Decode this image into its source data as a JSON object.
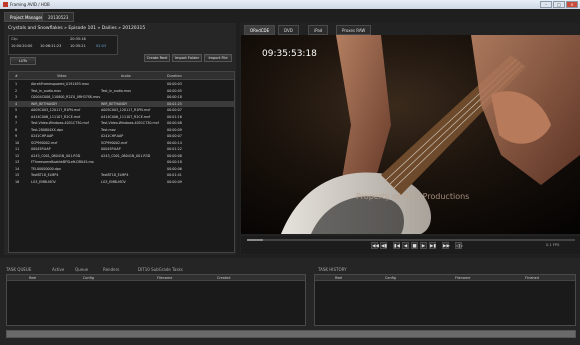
{
  "window": {
    "title": "Framing AVID / HOB",
    "minimize": "–",
    "maximize": "□",
    "close": "×"
  },
  "tabs": [
    {
      "label": "Project Manager"
    },
    {
      "label": "20130523"
    }
  ],
  "left": {
    "breadcrumb": "Crystals and Snowflakes » Episode 101 » Dailies » 20120315",
    "clip": {
      "clip_label": "Clip",
      "tc_in": "10:00:20:00",
      "tc_out": "10:06:21:23",
      "rows": [
        "20:35:18",
        "10:35:21",
        "02:03"
      ]
    },
    "luts_button": "LUTs",
    "create_reel_button": "Create Reel",
    "import_folder_button": "Import Folder",
    "import_file_button": "Import File",
    "columns": [
      "#",
      "Video",
      "Audio",
      "Duration"
    ],
    "rows": [
      {
        "n": "1",
        "video": "AbrahFramesquared_0191493.mov",
        "audio": "",
        "dur": "00:00:03"
      },
      {
        "n": "2",
        "video": "Test_in_audio.mov",
        "audio": "Test_in_audio.mov",
        "dur": "00:00:05"
      },
      {
        "n": "3",
        "video": "C0004C006_110800_R2ZX_0RH37SK.mov",
        "audio": "",
        "dur": "00:00:18"
      },
      {
        "n": "4",
        "video": "WIR_BETHANDY",
        "audio": "WIR_BETHANDY",
        "dur": "00:01:25"
      },
      {
        "n": "5",
        "video": "A005C003_120117_R1PN.mxf",
        "audio": "A005C003_120117_R1PN.mxf",
        "dur": "00:00:07"
      },
      {
        "n": "6",
        "video": "A414C006_111107_R2CE.mxf",
        "audio": "A414C006_111107_R2CE.mxf",
        "dur": "00:01:16"
      },
      {
        "n": "7",
        "video": "Test.Video.Windows.4051CT30.mxf",
        "audio": "Test.Video.Windows.4051CT30.mxf",
        "dur": "00:00:08"
      },
      {
        "n": "8",
        "video": "Test-280804XX.dpx",
        "audio": "Test.mov",
        "dur": "00:00:09"
      },
      {
        "n": "9",
        "video": "0241CHP.AAP",
        "audio": "0241CHP.AAP",
        "dur": "00:00:07"
      },
      {
        "n": "10",
        "video": "SCP990002.mxf",
        "audio": "SCP990002.mxf",
        "dur": "00:00:14"
      },
      {
        "n": "11",
        "video": "00045P.AAP",
        "audio": "00045P.AAP",
        "dur": "00:01:22"
      },
      {
        "n": "12",
        "video": "A243_C001_08041N_001.R3D",
        "audio": "A243_C001_08041N_001.R3D",
        "dur": "00:00:08"
      },
      {
        "n": "13",
        "video": "FThreesomeBoathkBFSLeft.DR045.mo",
        "audio": "",
        "dur": "00:00:18"
      },
      {
        "n": "14",
        "video": "TEL00000000.dpx",
        "audio": "",
        "dur": "00:00:06"
      },
      {
        "n": "15",
        "video": "TestBT18_ELMP4",
        "audio": "TestBT18_ELMP4",
        "dur": "00:01:41"
      },
      {
        "n": "16",
        "video": "LG3_EMBLMOV",
        "audio": "LG3_EMBLMOV",
        "dur": "00:00:09"
      }
    ]
  },
  "viewer": {
    "tabs": [
      {
        "label": "ORedCDE"
      },
      {
        "label": "DVD"
      },
      {
        "label": "iPad"
      },
      {
        "label": "Proxes RAW"
      }
    ],
    "timecode": "09:35:53:18",
    "watermark": "Property of H2O Productions",
    "transport": [
      "◀◀",
      "◀▮",
      "▮◀",
      "◀",
      "■",
      "▶",
      "▶▮",
      "▶▶",
      "◁▷"
    ],
    "speed_label": "0.1 FPS",
    "playhead_fraction": 0.05
  },
  "bottom": {
    "task_queue_title": "TASK QUEUE",
    "queue_tabs": [
      "Active",
      "Queue",
      "Renders",
      "DIT10 SubGrade Tasks"
    ],
    "queue_columns": [
      "Reel",
      "Config",
      "Filename",
      "Created"
    ],
    "task_history_title": "TASK HISTORY",
    "history_columns": [
      "Reel",
      "Config",
      "Filename",
      "Finished"
    ]
  },
  "colors": {
    "accent": "#3b3b3b",
    "background": "#1f1f1f",
    "panel": "#262626"
  }
}
